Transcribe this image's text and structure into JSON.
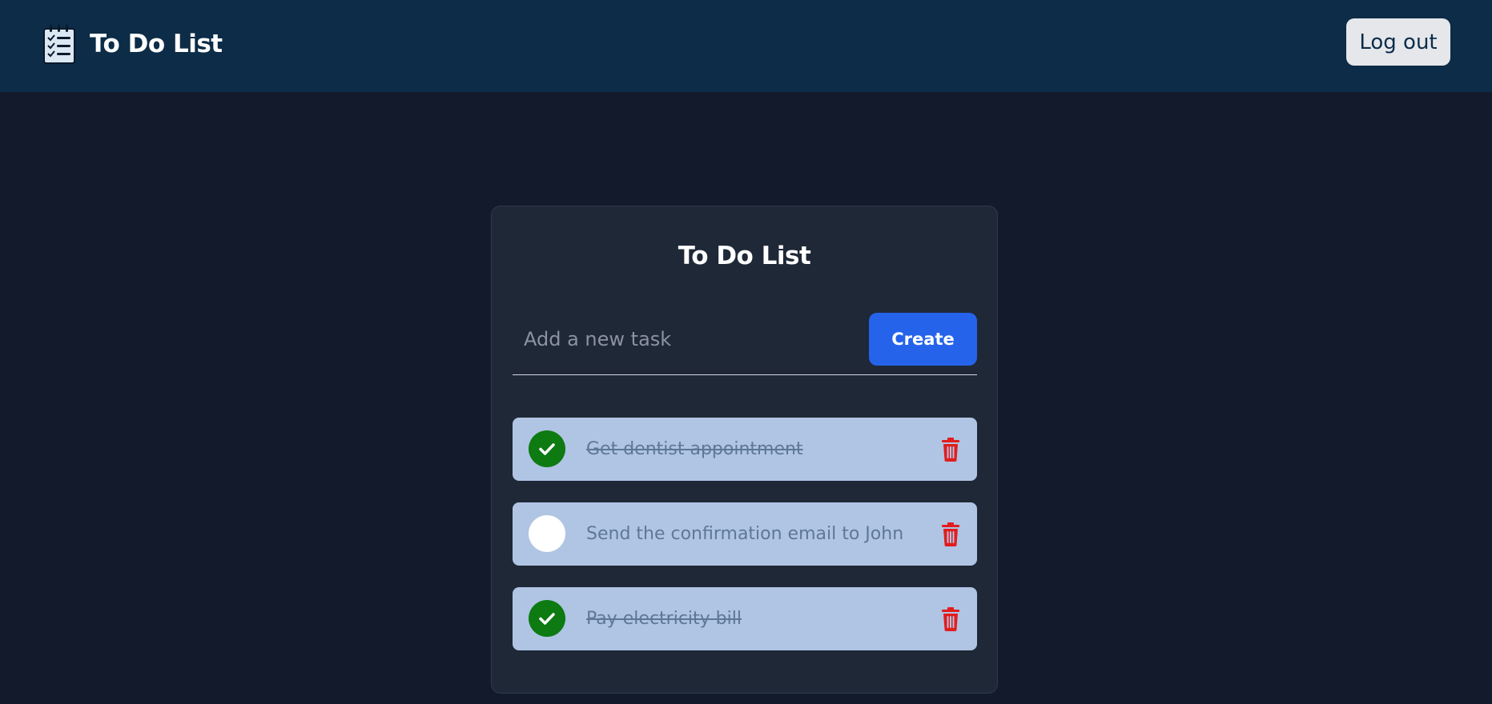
{
  "header": {
    "title": "To Do List",
    "logout_label": "Log out",
    "background_color": "#0c2c48"
  },
  "main": {
    "card_title": "To Do List",
    "new_task": {
      "placeholder": "Add a new task",
      "value": "",
      "create_label": "Create",
      "accent_color": "#2563eb"
    },
    "tasks": [
      {
        "text": "Get dentist appointment",
        "completed": true
      },
      {
        "text": "Send the confirmation email to John",
        "completed": false
      },
      {
        "text": "Pay electricity bill",
        "completed": true
      }
    ]
  },
  "colors": {
    "page_background": "#131a2b",
    "card_background": "#1f2837",
    "task_background": "#b0c4e3",
    "completed_check": "#0d7a12",
    "delete_icon": "#e11d1d"
  },
  "icons": {
    "brand": "notepad-checklist-icon",
    "complete": "checkmark-icon",
    "delete": "trash-icon"
  }
}
